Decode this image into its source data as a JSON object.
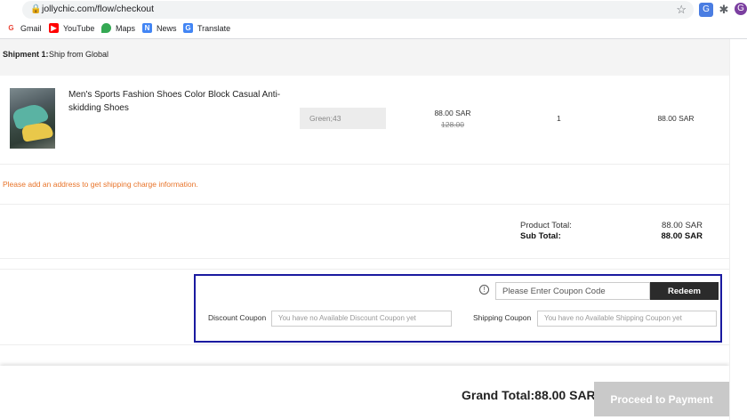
{
  "browser": {
    "url": "jollychic.com/flow/checkout",
    "bookmarks": [
      {
        "label": "Gmail",
        "icon": "gmail-icon",
        "color": "#ea4335"
      },
      {
        "label": "YouTube",
        "icon": "youtube-icon",
        "color": "#ff0000"
      },
      {
        "label": "Maps",
        "icon": "maps-icon",
        "color": "#34a853"
      },
      {
        "label": "News",
        "icon": "news-icon",
        "color": "#4285f4"
      },
      {
        "label": "Translate",
        "icon": "translate-icon",
        "color": "#4285f4"
      }
    ]
  },
  "shipment": {
    "label": "Shipment 1:",
    "value": "Ship from Global"
  },
  "item": {
    "title": "Men's Sports Fashion Shoes Color Block Casual Anti-skidding Shoes",
    "variant": "Green;43",
    "price": "88.00 SAR",
    "old_price": "128.00",
    "quantity": "1",
    "line_total": "88.00 SAR"
  },
  "warning": "Please add an address to get shipping charge information.",
  "totals": {
    "product_total_label": "Product Total:",
    "product_total_value": "88.00 SAR",
    "sub_total_label": "Sub Total:",
    "sub_total_value": "88.00 SAR"
  },
  "coupon": {
    "code_placeholder": "Please Enter Coupon Code",
    "redeem_label": "Redeem",
    "discount_label": "Discount Coupon",
    "discount_value": "You have no Available Discount Coupon yet",
    "shipping_label": "Shipping Coupon",
    "shipping_value": "You have no Available Shipping Coupon yet"
  },
  "footer": {
    "grand_total": "Grand Total:88.00 SAR",
    "proceed_label": "Proceed to Payment"
  },
  "colors": {
    "accent_border": "#1a1aa0",
    "warning": "#e8742a",
    "button_dark": "#2b2b2b",
    "button_disabled": "#c9c9c9"
  }
}
